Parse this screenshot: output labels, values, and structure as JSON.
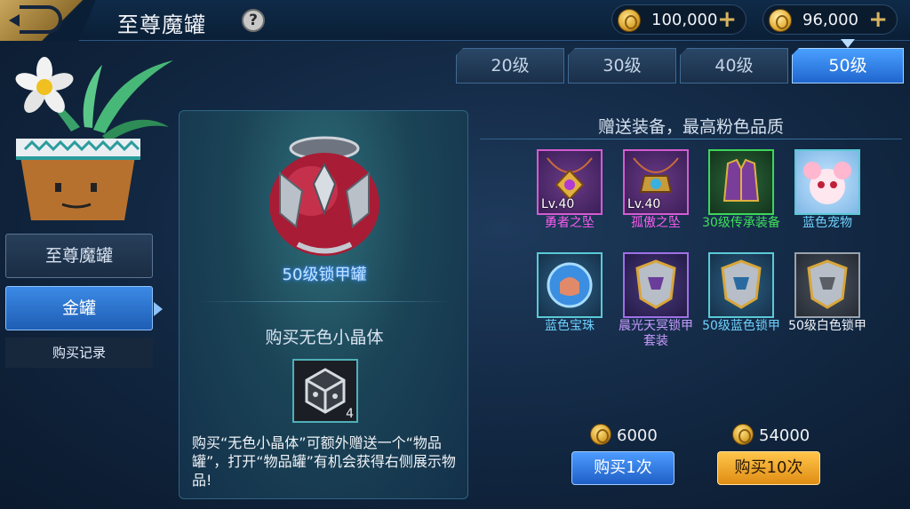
{
  "header": {
    "title": "至尊魔罐",
    "help_label": "?",
    "currencies": [
      {
        "value": "100,000",
        "plus": "+",
        "icon": "gold-coin-icon"
      },
      {
        "value": "96,000",
        "plus": "+",
        "icon": "diamond-coin-icon"
      }
    ]
  },
  "sidebar": {
    "tabs": [
      {
        "label": "至尊魔罐",
        "active": false
      },
      {
        "label": "金罐",
        "active": true
      }
    ],
    "history_label": "购买记录"
  },
  "level_tabs": [
    {
      "label": "20级",
      "active": false
    },
    {
      "label": "30级",
      "active": false
    },
    {
      "label": "40级",
      "active": false
    },
    {
      "label": "50级",
      "active": true
    }
  ],
  "center": {
    "jar_name": "50级锁甲罐",
    "buy_title": "购买无色小晶体",
    "crystal_count": "4",
    "description": "购买“无色小晶体”可额外赠送一个“物品罐”，打开“物品罐”有机会获得右侧展示物品!"
  },
  "rewards": {
    "title": "赠送装备，最高粉色品质",
    "items": [
      {
        "name": "勇者之坠",
        "level": "Lv.40",
        "quality": "pink"
      },
      {
        "name": "孤傲之坠",
        "level": "Lv.40",
        "quality": "pink"
      },
      {
        "name": "30级传承装备",
        "level": "",
        "quality": "green"
      },
      {
        "name": "蓝色宠物",
        "level": "",
        "quality": "blue"
      },
      {
        "name": "蓝色宝珠",
        "level": "",
        "quality": "blue"
      },
      {
        "name": "晨光天冥锁甲套装",
        "level": "",
        "quality": "purple"
      },
      {
        "name": "50级蓝色锁甲",
        "level": "",
        "quality": "blue"
      },
      {
        "name": "50级白色锁甲",
        "level": "",
        "quality": "white"
      }
    ]
  },
  "purchase": {
    "price_one": "6000",
    "price_ten": "54000",
    "buy_one_label": "购买1次",
    "buy_ten_label": "购买10次"
  },
  "colors": {
    "pink_quality": "#ff5cf0",
    "green_quality": "#3fe05a",
    "blue_quality": "#6fd2ff",
    "purple_quality": "#c89cff",
    "active_tab": "#1f66cf",
    "gold_button": "#e08d14"
  }
}
